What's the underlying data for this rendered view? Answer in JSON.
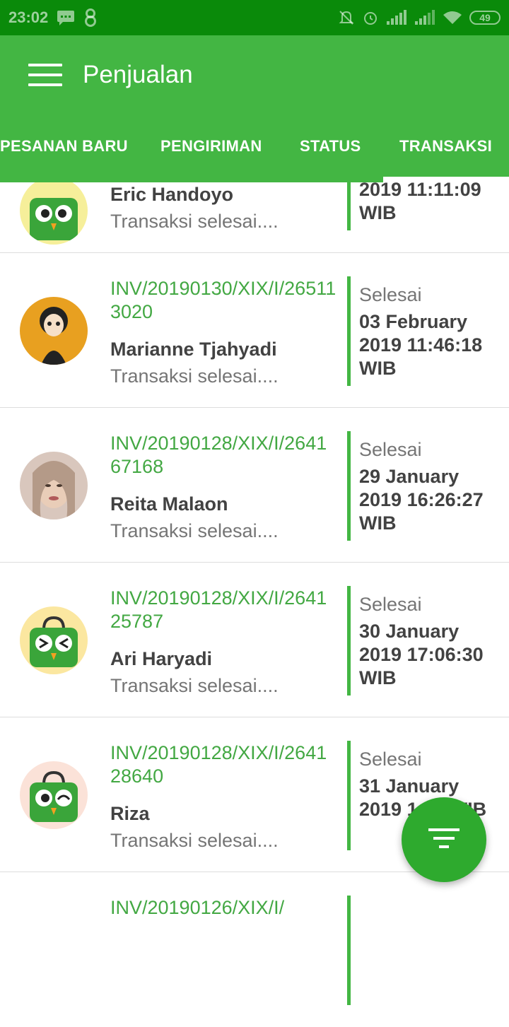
{
  "status_bar": {
    "time": "23:02",
    "battery": "49",
    "icons": [
      "chat-icon",
      "infinity-icon",
      "silent-bell-icon",
      "alarm-icon",
      "signal-icon",
      "signal-icon",
      "wifi-icon",
      "battery-icon"
    ]
  },
  "app_bar": {
    "title": "Penjualan",
    "menu_icon": "hamburger-menu-icon",
    "tabs": [
      {
        "label": "PESANAN BARU"
      },
      {
        "label": "PENGIRIMAN"
      },
      {
        "label": "STATUS"
      },
      {
        "label": "TRANSAKSI",
        "selected": true
      }
    ]
  },
  "transactions": [
    {
      "invoice": "",
      "name": "Eric Handoyo",
      "message": "Transaksi selesai....",
      "status": "",
      "date": "2019 11:11:09 WIB",
      "avatar": "tokopedia-owl-avatar"
    },
    {
      "invoice": "INV/20190130/XIX/I/265113020",
      "name": "Marianne Tjahyadi",
      "message": "Transaksi selesai....",
      "status": "Selesai",
      "date": "03 February 2019 11:46:18 WIB",
      "avatar": "betty-boop-avatar"
    },
    {
      "invoice": "INV/20190128/XIX/I/264167168",
      "name": "Reita Malaon",
      "message": "Transaksi selesai....",
      "status": "Selesai",
      "date": "29 January 2019 16:26:27 WIB",
      "avatar": "woman-photo-avatar"
    },
    {
      "invoice": "INV/20190128/XIX/I/264125787",
      "name": "Ari Haryadi",
      "message": "Transaksi selesai....",
      "status": "Selesai",
      "date": "30 January 2019 17:06:30 WIB",
      "avatar": "tokopedia-owl-avatar"
    },
    {
      "invoice": "INV/20190128/XIX/I/264128640",
      "name": "Riza",
      "message": "Transaksi selesai....",
      "status": "Selesai",
      "date": "31 January 2019 1  43 WIB",
      "avatar": "tokopedia-owl-avatar"
    },
    {
      "invoice": "INV/20190126/XIX/I/",
      "name": "",
      "message": "",
      "status": "",
      "date": "",
      "avatar": ""
    }
  ],
  "fab": {
    "icon": "filter-icon"
  },
  "colors": {
    "status_bar": "#0a8a0a",
    "app_bar": "#43b643",
    "accent": "#43a843",
    "fab": "#2eaa2e"
  }
}
